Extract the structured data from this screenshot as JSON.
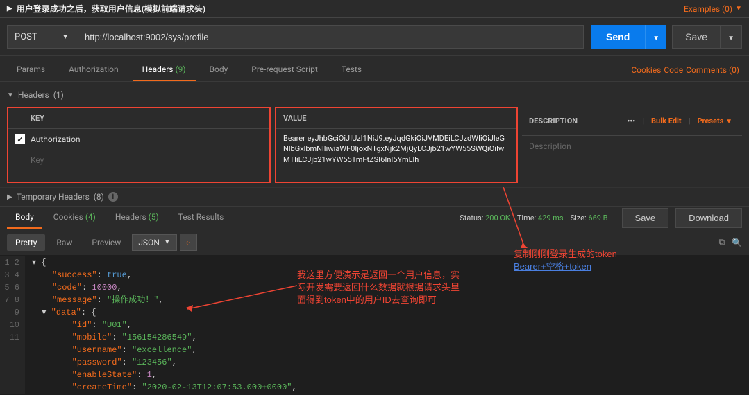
{
  "titlebar": {
    "title": "用户登录成功之后，获取用户信息(模拟前端请求头)",
    "examples_label": "Examples (0)"
  },
  "request": {
    "method": "POST",
    "url": "http://localhost:9002/sys/profile",
    "send_label": "Send",
    "save_label": "Save"
  },
  "tabs": {
    "params": "Params",
    "authorization": "Authorization",
    "headers_label": "Headers",
    "headers_count": "(9)",
    "body": "Body",
    "prerequest": "Pre-request Script",
    "tests": "Tests",
    "cookies": "Cookies",
    "code": "Code",
    "comments": "Comments (0)"
  },
  "headers_section": {
    "section_label": "Headers",
    "section_count": "(1)",
    "col_key": "KEY",
    "col_value": "VALUE",
    "col_desc": "DESCRIPTION",
    "row_key": "Authorization",
    "row_value": "Bearer\neyJhbGciOiJIUzI1NiJ9.eyJqdGkiOiJVMDEiLCJzdWIiOiJleGNlbGxlbmNlIiwiaWF0IjoxNTgxNjk2MjQyLCJjb21wYW55SWQiOiIwMTIiLCJjb21wYW55TmFtZSI6InI5YmLlh",
    "key_placeholder": "Key",
    "desc_placeholder": "Description",
    "dots": "•••",
    "bulk_edit": "Bulk Edit",
    "presets": "Presets"
  },
  "temp_headers": {
    "label": "Temporary Headers",
    "count": "(8)"
  },
  "response_tabs": {
    "body": "Body",
    "cookies": "Cookies",
    "cookies_count": "(4)",
    "headers": "Headers",
    "headers_count": "(5)",
    "test_results": "Test Results"
  },
  "response_meta": {
    "status_label": "Status:",
    "status_value": "200 OK",
    "time_label": "Time:",
    "time_value": "429 ms",
    "size_label": "Size:",
    "size_value": "669 B",
    "save_btn": "Save",
    "download_btn": "Download"
  },
  "viewer": {
    "pretty": "Pretty",
    "raw": "Raw",
    "preview": "Preview",
    "format": "JSON"
  },
  "json_body": {
    "success": "true",
    "code": "10000",
    "message": "\"操作成功！\"",
    "data_id": "\"U01\"",
    "data_mobile": "\"156154286549\"",
    "data_username": "\"excellence\"",
    "data_password": "\"123456\"",
    "data_enableState": "1",
    "data_createTime": "\"2020-02-13T12:07:53.000+0000\""
  },
  "annotations": {
    "red1": "复制刚刚登录生成的token",
    "blue1": "Bearer+空格+token",
    "left1": "我这里方便演示是返回一个用户信息，实",
    "left2": "际开发需要返回什么数据就根据请求头里",
    "left3": "面得到token中的用户ID去查询即可"
  }
}
